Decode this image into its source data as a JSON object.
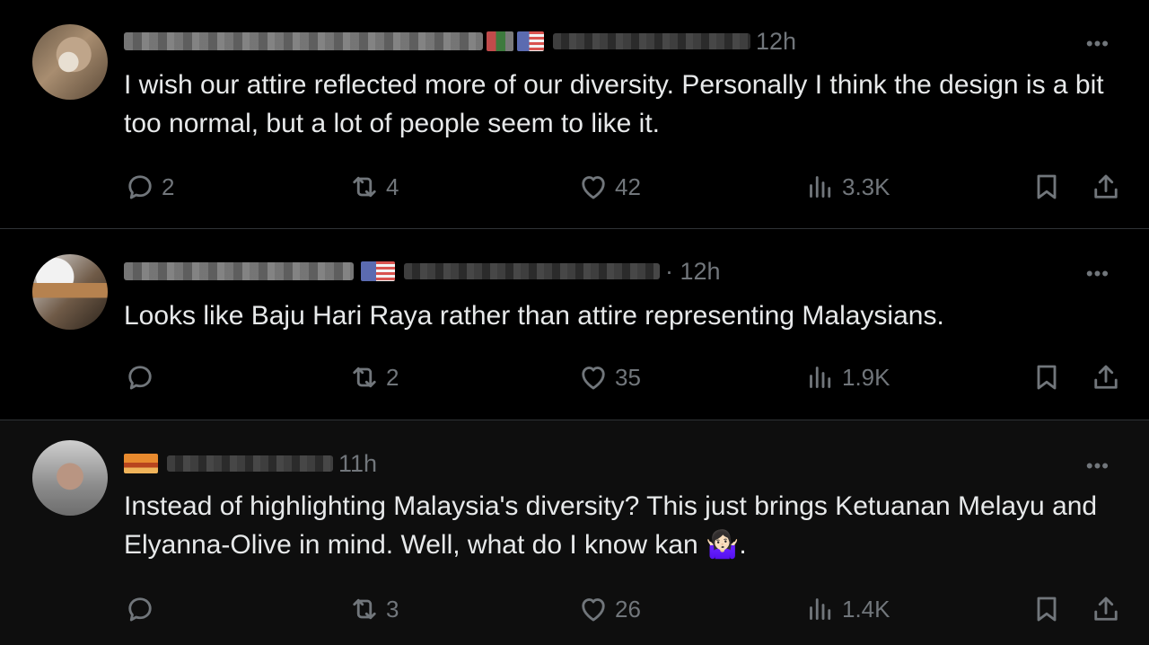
{
  "posts": [
    {
      "time": "12h",
      "text": "I wish our attire reflected more of our diversity. Personally I think the design is a bit too normal, but a lot of people seem to like it.",
      "replies": "2",
      "reposts": "4",
      "likes": "42",
      "views": "3.3K"
    },
    {
      "time": "· 12h",
      "text": "Looks like Baju Hari Raya rather than attire  representing Malaysians.",
      "replies": "",
      "reposts": "2",
      "likes": "35",
      "views": "1.9K"
    },
    {
      "time": "11h",
      "text": "Instead of highlighting Malaysia's diversity? This just brings Ketuanan Melayu and Elyanna-Olive in mind. Well, what do I know kan 🤷🏻‍♀️.",
      "replies": "",
      "reposts": "3",
      "likes": "26",
      "views": "1.4K"
    }
  ],
  "more_label": "•••",
  "icons": [
    "reply-icon",
    "repost-icon",
    "like-icon",
    "views-icon",
    "bookmark-icon",
    "share-icon",
    "more-icon"
  ],
  "colors": {
    "background": "#000000",
    "text": "#e7e9ea",
    "muted": "#71767b",
    "divider": "#2f3336"
  }
}
